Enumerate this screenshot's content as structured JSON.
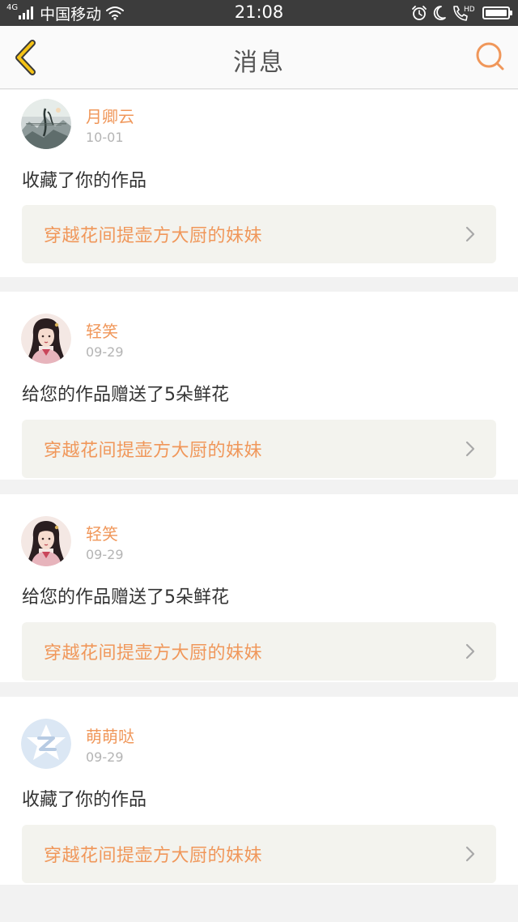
{
  "status_bar": {
    "network": "4G",
    "carrier": "中国移动",
    "time": "21:08",
    "hd_label": "HD"
  },
  "header": {
    "title": "消息",
    "back_icon": "chevron-left-icon",
    "search_icon": "search-icon",
    "back_color": "#f5c316",
    "accent_color": "#f0975a"
  },
  "messages": [
    {
      "user": "月卿云",
      "date": "10-01",
      "action": "收藏了你的作品",
      "work_title": "穿越花间提壶方大厨的妹妹",
      "avatar": "landscape-art-avatar"
    },
    {
      "user": "轻笑",
      "date": "09-29",
      "action": "给您的作品赠送了5朵鲜花",
      "work_title": "穿越花间提壶方大厨的妹妹",
      "avatar": "ancient-lady-avatar"
    },
    {
      "user": "轻笑",
      "date": "09-29",
      "action": "给您的作品赠送了5朵鲜花",
      "work_title": "穿越花间提壶方大厨的妹妹",
      "avatar": "ancient-lady-avatar"
    },
    {
      "user": "萌萌哒",
      "date": "09-29",
      "action": "收藏了你的作品",
      "work_title": "穿越花间提壶方大厨的妹妹",
      "avatar": "default-z-avatar"
    }
  ]
}
